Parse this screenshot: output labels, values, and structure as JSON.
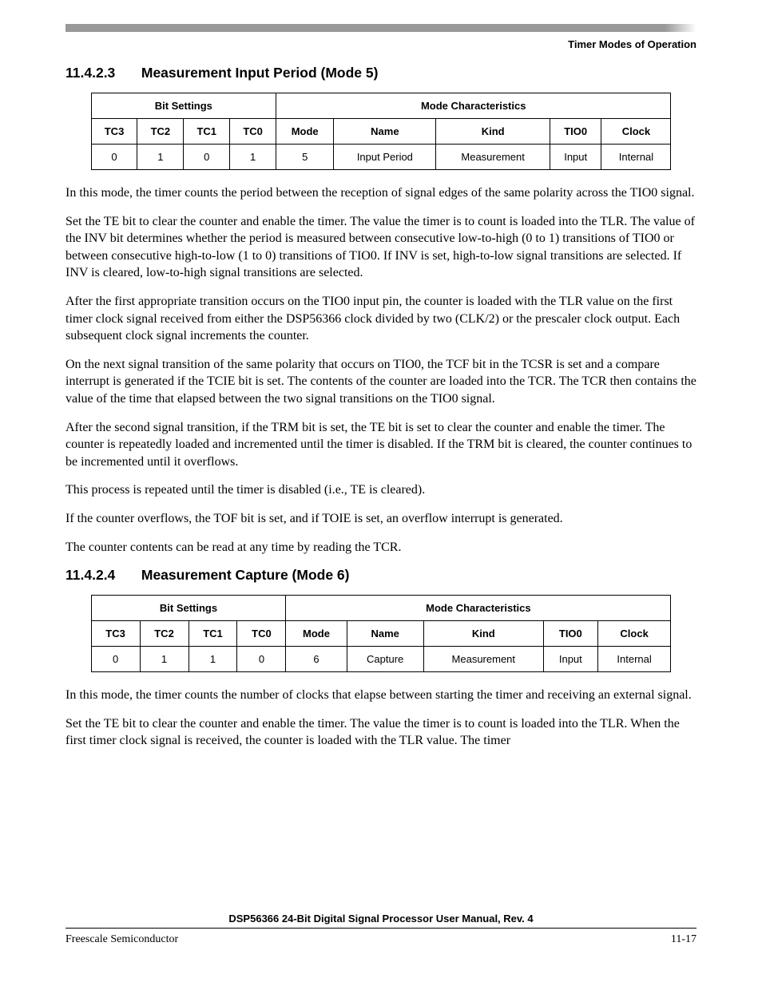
{
  "header": {
    "title": "Timer Modes of Operation"
  },
  "section1": {
    "num": "11.4.2.3",
    "title": "Measurement Input Period (Mode 5)",
    "table": {
      "group_left": "Bit Settings",
      "group_right": "Mode Characteristics",
      "cols": [
        "TC3",
        "TC2",
        "TC1",
        "TC0",
        "Mode",
        "Name",
        "Kind",
        "TIO0",
        "Clock"
      ],
      "row": [
        "0",
        "1",
        "0",
        "1",
        "5",
        "Input Period",
        "Measurement",
        "Input",
        "Internal"
      ]
    },
    "paras": [
      "In this mode, the timer counts the period between the reception of signal edges of the same polarity across the TIO0 signal.",
      "Set the TE bit to clear the counter and enable the timer. The value the timer is to count is loaded into the TLR. The value of the INV bit determines whether the period is measured between consecutive low-to-high (0 to 1) transitions of TIO0 or between consecutive high-to-low (1 to 0) transitions of TIO0. If INV is set, high-to-low signal transitions are selected. If INV is cleared, low-to-high signal transitions are selected.",
      "After the first appropriate transition occurs on the TIO0 input pin, the counter is loaded with the TLR value on the first timer clock signal received from either the DSP56366 clock divided by two (CLK/2) or the prescaler clock output. Each subsequent clock signal increments the counter.",
      "On the next signal transition of the same polarity that occurs on TIO0, the TCF bit in the TCSR is set and a compare interrupt is generated if the TCIE bit is set. The contents of the counter are loaded into the TCR. The TCR then contains the value of the time that elapsed between the two signal transitions on the TIO0 signal.",
      "After the second signal transition, if the TRM bit is set, the TE bit is set to clear the counter and enable the timer. The counter is repeatedly loaded and incremented until the timer is disabled. If the TRM bit is cleared, the counter continues to be incremented until it overflows.",
      "This process is repeated until the timer is disabled (i.e., TE is cleared).",
      "If the counter overflows, the TOF bit is set, and if TOIE is set, an overflow interrupt is generated.",
      "The counter contents can be read at any time by reading the TCR."
    ]
  },
  "section2": {
    "num": "11.4.2.4",
    "title": "Measurement Capture (Mode 6)",
    "table": {
      "group_left": "Bit Settings",
      "group_right": "Mode Characteristics",
      "cols": [
        "TC3",
        "TC2",
        "TC1",
        "TC0",
        "Mode",
        "Name",
        "Kind",
        "TIO0",
        "Clock"
      ],
      "row": [
        "0",
        "1",
        "1",
        "0",
        "6",
        "Capture",
        "Measurement",
        "Input",
        "Internal"
      ]
    },
    "paras": [
      "In this mode, the timer counts the number of clocks that elapse between starting the timer and receiving an external signal.",
      "Set the TE bit to clear the counter and enable the timer. The value the timer is to count is loaded into the TLR. When the first timer clock signal is received, the counter is loaded with the TLR value. The timer"
    ]
  },
  "footer": {
    "title": "DSP56366 24-Bit Digital Signal Processor User Manual, Rev. 4",
    "left": "Freescale Semiconductor",
    "right": "11-17"
  }
}
